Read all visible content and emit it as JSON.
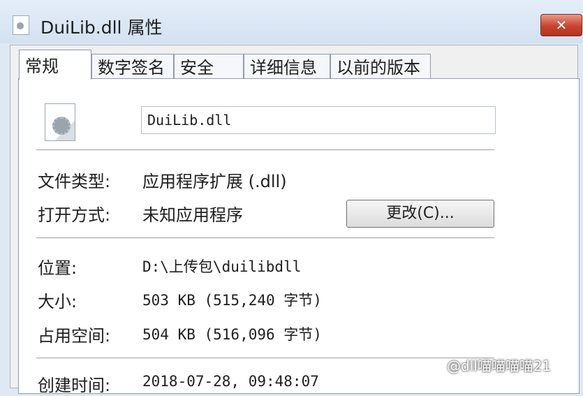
{
  "window": {
    "title": "DuiLib.dll 属性",
    "close_symbol": "✕"
  },
  "tabs": [
    {
      "label": "常规",
      "active": true
    },
    {
      "label": "数字签名",
      "active": false
    },
    {
      "label": "安全",
      "active": false
    },
    {
      "label": "详细信息",
      "active": false
    },
    {
      "label": "以前的版本",
      "active": false
    }
  ],
  "general": {
    "file_name": "DuiLib.dll",
    "file_type_label": "文件类型:",
    "file_type_value": "应用程序扩展 (.dll)",
    "opens_with_label": "打开方式:",
    "opens_with_value": "未知应用程序",
    "change_button": "更改(C)...",
    "location_label": "位置:",
    "location_value": "D:\\上传包\\duilibdll",
    "size_label": "大小:",
    "size_value": "503 KB (515,240 字节)",
    "size_on_disk_label": "占用空间:",
    "size_on_disk_value": "504 KB (516,096 字节)",
    "created_label": "创建时间:",
    "created_value": "2018-07-28, 09:48:07"
  },
  "watermark": "@dll喵喵喵喵21"
}
